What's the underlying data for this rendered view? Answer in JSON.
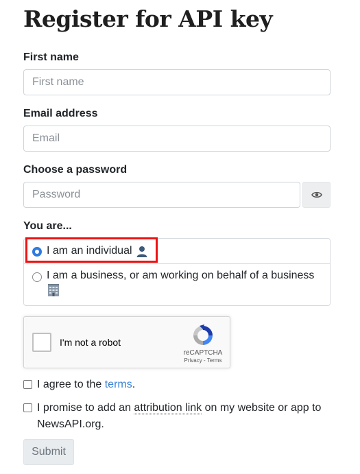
{
  "page": {
    "title": "Register for API key"
  },
  "form": {
    "first_name": {
      "label": "First name",
      "placeholder": "First name"
    },
    "email": {
      "label": "Email address",
      "placeholder": "Email"
    },
    "password": {
      "label": "Choose a password",
      "placeholder": "Password",
      "toggle_icon": "eye-icon"
    },
    "account_type": {
      "label": "You are...",
      "options": [
        {
          "label": "I am an individual",
          "icon": "person-silhouette",
          "checked": true
        },
        {
          "label": "I am a business, or am working on behalf of a business",
          "icon": "office-building",
          "checked": false
        }
      ]
    },
    "captcha": {
      "label": "I'm not a robot",
      "brand": "reCAPTCHA",
      "links": "Privacy - Terms"
    },
    "agree": {
      "prefix": "I agree to the ",
      "link": "terms",
      "suffix": "."
    },
    "attribution": {
      "prefix": "I promise to add an ",
      "link": "attribution link",
      "suffix": " on my website or app to NewsAPI.org."
    },
    "submit_label": "Submit"
  },
  "colors": {
    "highlight": "#ee1111",
    "link": "#3b82d6",
    "radio_checked": "#2f7be0"
  }
}
